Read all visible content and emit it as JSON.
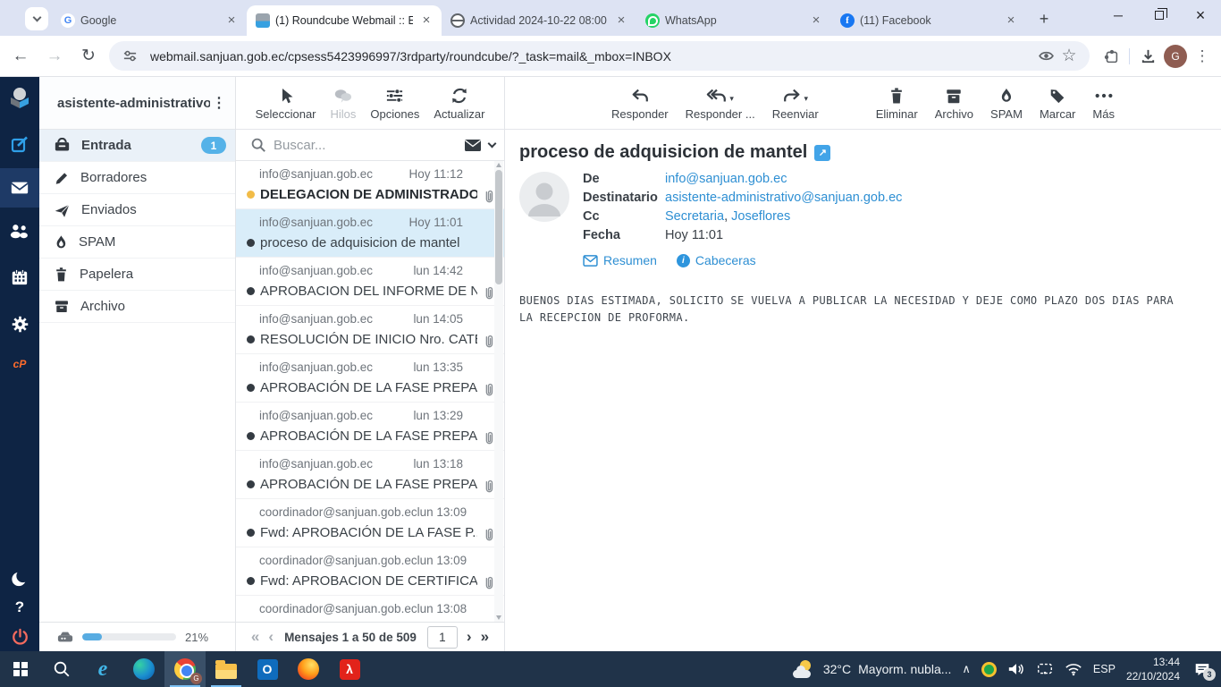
{
  "browser": {
    "tabs": [
      {
        "title": "Google",
        "favicon": "google",
        "active": false
      },
      {
        "title": "(1) Roundcube Webmail :: En",
        "favicon": "roundcube",
        "active": true
      },
      {
        "title": "Actividad 2024-10-22 08:00:",
        "favicon": "globe",
        "active": false
      },
      {
        "title": "WhatsApp",
        "favicon": "whatsapp",
        "active": false
      },
      {
        "title": "(11) Facebook",
        "favicon": "facebook",
        "active": false
      }
    ],
    "url": "webmail.sanjuan.gob.ec/cpsess5423996997/3rdparty/roundcube/?_task=mail&_mbox=INBOX",
    "avatar_letter": "G"
  },
  "glyphs": {
    "back": "←",
    "forward": "→",
    "reload": "↻",
    "star": "☆",
    "kebab": "⋮",
    "close": "×",
    "plus": "+",
    "minimize": "─",
    "extlink": "↗",
    "first": "«",
    "prev": "‹",
    "next": "›",
    "last": "»",
    "caret_down": "▾",
    "tray_chevron": "∧",
    "fav_google": "G",
    "fav_facebook": "f",
    "ie": "e",
    "outlook": "O",
    "acrobat": "λ",
    "help": "?",
    "cpanel": "cP",
    "chrome_badge": "G"
  },
  "folders": {
    "account": "asistente-administrativo...",
    "items": [
      {
        "label": "Entrada",
        "badge": "1"
      },
      {
        "label": "Borradores"
      },
      {
        "label": "Enviados"
      },
      {
        "label": "SPAM"
      },
      {
        "label": "Papelera"
      },
      {
        "label": "Archivo"
      }
    ]
  },
  "list_toolbar": {
    "seleccionar": "Seleccionar",
    "hilos": "Hilos",
    "opciones": "Opciones",
    "actualizar": "Actualizar"
  },
  "search": {
    "placeholder": "Buscar..."
  },
  "messages": [
    {
      "sender": "info@sanjuan.gob.ec",
      "date": "Hoy 11:12",
      "subject": "DELEGACION DE ADMINISTRADO...",
      "dot": "yellow",
      "unread": true,
      "attachment": true,
      "selected": false
    },
    {
      "sender": "info@sanjuan.gob.ec",
      "date": "Hoy 11:01",
      "subject": "proceso de adquisicion de mantel",
      "dot": "dark",
      "unread": false,
      "attachment": false,
      "selected": true
    },
    {
      "sender": "info@sanjuan.gob.ec",
      "date": "lun 14:42",
      "subject": "APROBACION DEL INFORME DE N...",
      "dot": "dark",
      "unread": false,
      "attachment": true,
      "selected": false
    },
    {
      "sender": "info@sanjuan.gob.ec",
      "date": "lun 14:05",
      "subject": "RESOLUCIÓN DE INICIO Nro. CATE...",
      "dot": "dark",
      "unread": false,
      "attachment": true,
      "selected": false
    },
    {
      "sender": "info@sanjuan.gob.ec",
      "date": "lun 13:35",
      "subject": "APROBACIÓN DE LA FASE PREPA...",
      "dot": "dark",
      "unread": false,
      "attachment": true,
      "selected": false
    },
    {
      "sender": "info@sanjuan.gob.ec",
      "date": "lun 13:29",
      "subject": "APROBACIÓN DE LA FASE PREPA...",
      "dot": "dark",
      "unread": false,
      "attachment": true,
      "selected": false
    },
    {
      "sender": "info@sanjuan.gob.ec",
      "date": "lun 13:18",
      "subject": "APROBACIÓN DE LA FASE PREPA...",
      "dot": "dark",
      "unread": false,
      "attachment": true,
      "selected": false
    },
    {
      "sender": "coordinador@sanjuan.gob.ec",
      "date": "lun 13:09",
      "subject": "Fwd: APROBACIÓN DE LA FASE P...",
      "dot": "dark",
      "unread": false,
      "attachment": true,
      "selected": false
    },
    {
      "sender": "coordinador@sanjuan.gob.ec",
      "date": "lun 13:09",
      "subject": "Fwd: APROBACION DE CERTIFICA...",
      "dot": "dark",
      "unread": false,
      "attachment": true,
      "selected": false
    },
    {
      "sender": "coordinador@sanjuan.gob.ec",
      "date": "lun 13:08",
      "subject": "",
      "dot": "none",
      "unread": false,
      "attachment": false,
      "selected": false
    }
  ],
  "mail_footer": {
    "quota": "21%",
    "quota_percent": 21,
    "pagination_text": "Mensajes 1 a 50 de 509",
    "page_input": "1"
  },
  "mail_toolbar": {
    "responder": "Responder",
    "responder_all": "Responder ...",
    "reenviar": "Reenviar",
    "eliminar": "Eliminar",
    "archivo": "Archivo",
    "spam": "SPAM",
    "marcar": "Marcar",
    "mas": "Más"
  },
  "message": {
    "subject": "proceso de adquisicion de mantel",
    "from_label": "De",
    "from": "info@sanjuan.gob.ec",
    "to_label": "Destinatario",
    "to": "asistente-administrativo@sanjuan.gob.ec",
    "cc_label": "Cc",
    "cc": [
      "Secretaria",
      "Joseflores"
    ],
    "date_label": "Fecha",
    "date": "Hoy 11:01",
    "resumen_label": "Resumen",
    "cabeceras_label": "Cabeceras",
    "body": "BUENOS DIAS ESTIMADA, SOLICITO SE VUELVA A PUBLICAR LA NECESIDAD Y DEJE COMO PLAZO DOS DIAS PARA LA RECEPCION DE PROFORMA."
  },
  "taskbar": {
    "weather_temp": "32°C",
    "weather_desc": "Mayorm. nubla...",
    "language": "ESP",
    "time": "13:44",
    "date": "22/10/2024",
    "notification_count": "3"
  }
}
